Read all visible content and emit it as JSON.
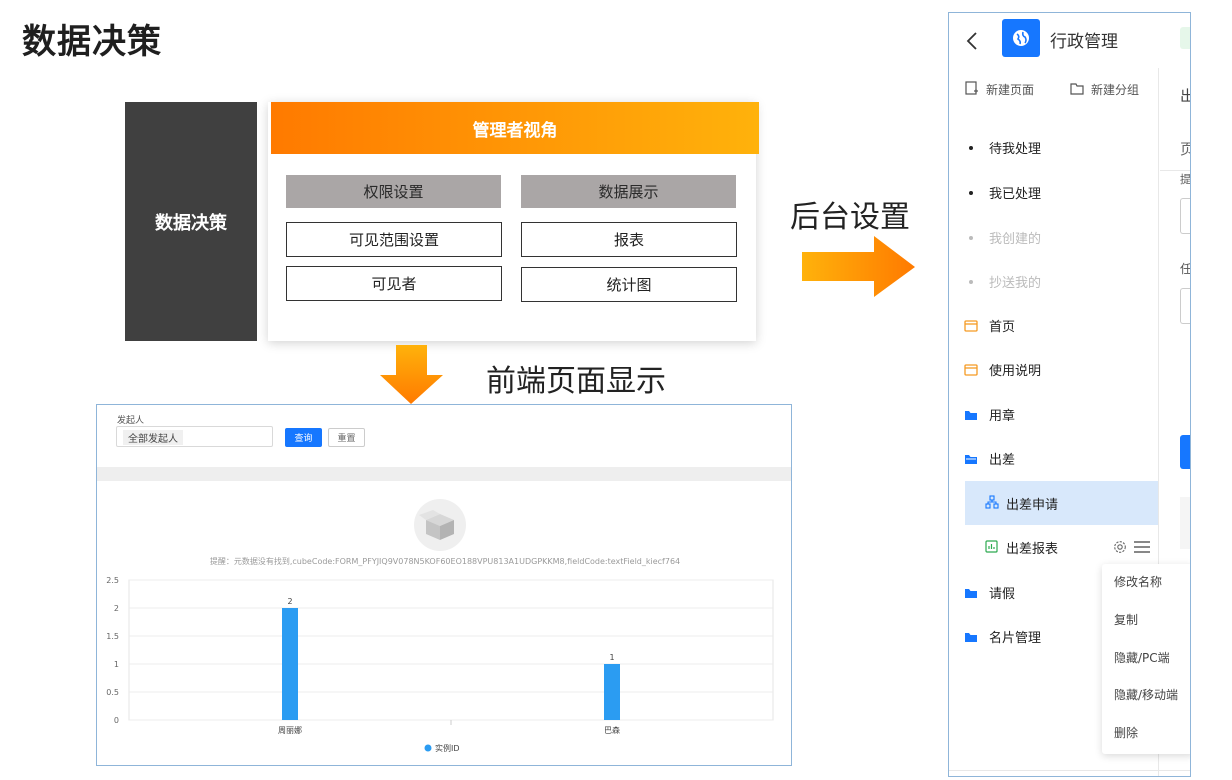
{
  "title": "数据决策",
  "left_block": {
    "label": "数据决策"
  },
  "manager": {
    "header": "管理者视角",
    "columns": [
      {
        "header": "权限设置",
        "items": [
          "可见范围设置",
          "可见者"
        ]
      },
      {
        "header": "数据展示",
        "items": [
          "报表",
          "统计图"
        ]
      }
    ]
  },
  "labels": {
    "backend": "后台设置",
    "frontend": "前端页面显示"
  },
  "colors": {
    "accent_orange": "#ff8a00",
    "accent_orange_light": "#ffb20b",
    "primary_blue": "#1677ff",
    "bar_blue": "#2b9cf2",
    "dark_block": "#404040"
  },
  "frontend": {
    "filter_label": "发起人",
    "filter_value": "全部发起人",
    "query_button": "查询",
    "reset_button": "重置",
    "empty_hint": "提醒：元数据没有找到,cubeCode:FORM_PFYJIQ9V078N5KOF60EO188VPU813A1UDGPKKM8,fieldCode:textField_kiecf764",
    "chart_data": {
      "type": "bar",
      "categories": [
        "周丽娜",
        "巴森"
      ],
      "series": [
        {
          "name": "实例ID",
          "values": [
            2,
            1
          ]
        }
      ],
      "yticks": [
        "0",
        "0.5",
        "1",
        "1.5",
        "2",
        "2.5"
      ],
      "ylim": [
        0,
        2.5
      ],
      "data_labels": [
        "2",
        "1"
      ],
      "legend": "实例ID",
      "legend_position": "bottom",
      "grid": true
    }
  },
  "backend": {
    "app_title": "行政管理",
    "new_page": "新建页面",
    "new_group": "新建分组",
    "nav": [
      {
        "label": "待我处理",
        "dim": false
      },
      {
        "label": "我已处理",
        "dim": false
      },
      {
        "label": "我创建的",
        "dim": true
      },
      {
        "label": "抄送我的",
        "dim": true
      }
    ],
    "pages": [
      {
        "label": "首页",
        "icon": "page-icon"
      },
      {
        "label": "使用说明",
        "icon": "page-icon"
      },
      {
        "label": "用章",
        "icon": "folder-icon"
      },
      {
        "label": "出差",
        "icon": "folder-open-icon"
      }
    ],
    "sub_items": [
      {
        "label": "出差申请",
        "icon": "flow-icon",
        "selected": true
      },
      {
        "label": "出差报表",
        "icon": "report-icon",
        "selected": false
      }
    ],
    "folders_after": [
      "请假",
      "名片管理"
    ],
    "context_menu": [
      "修改名称",
      "复制",
      "隐藏/PC端",
      "隐藏/移动端",
      "删除"
    ],
    "partial_text": [
      "出",
      "页",
      "提",
      "任"
    ]
  }
}
